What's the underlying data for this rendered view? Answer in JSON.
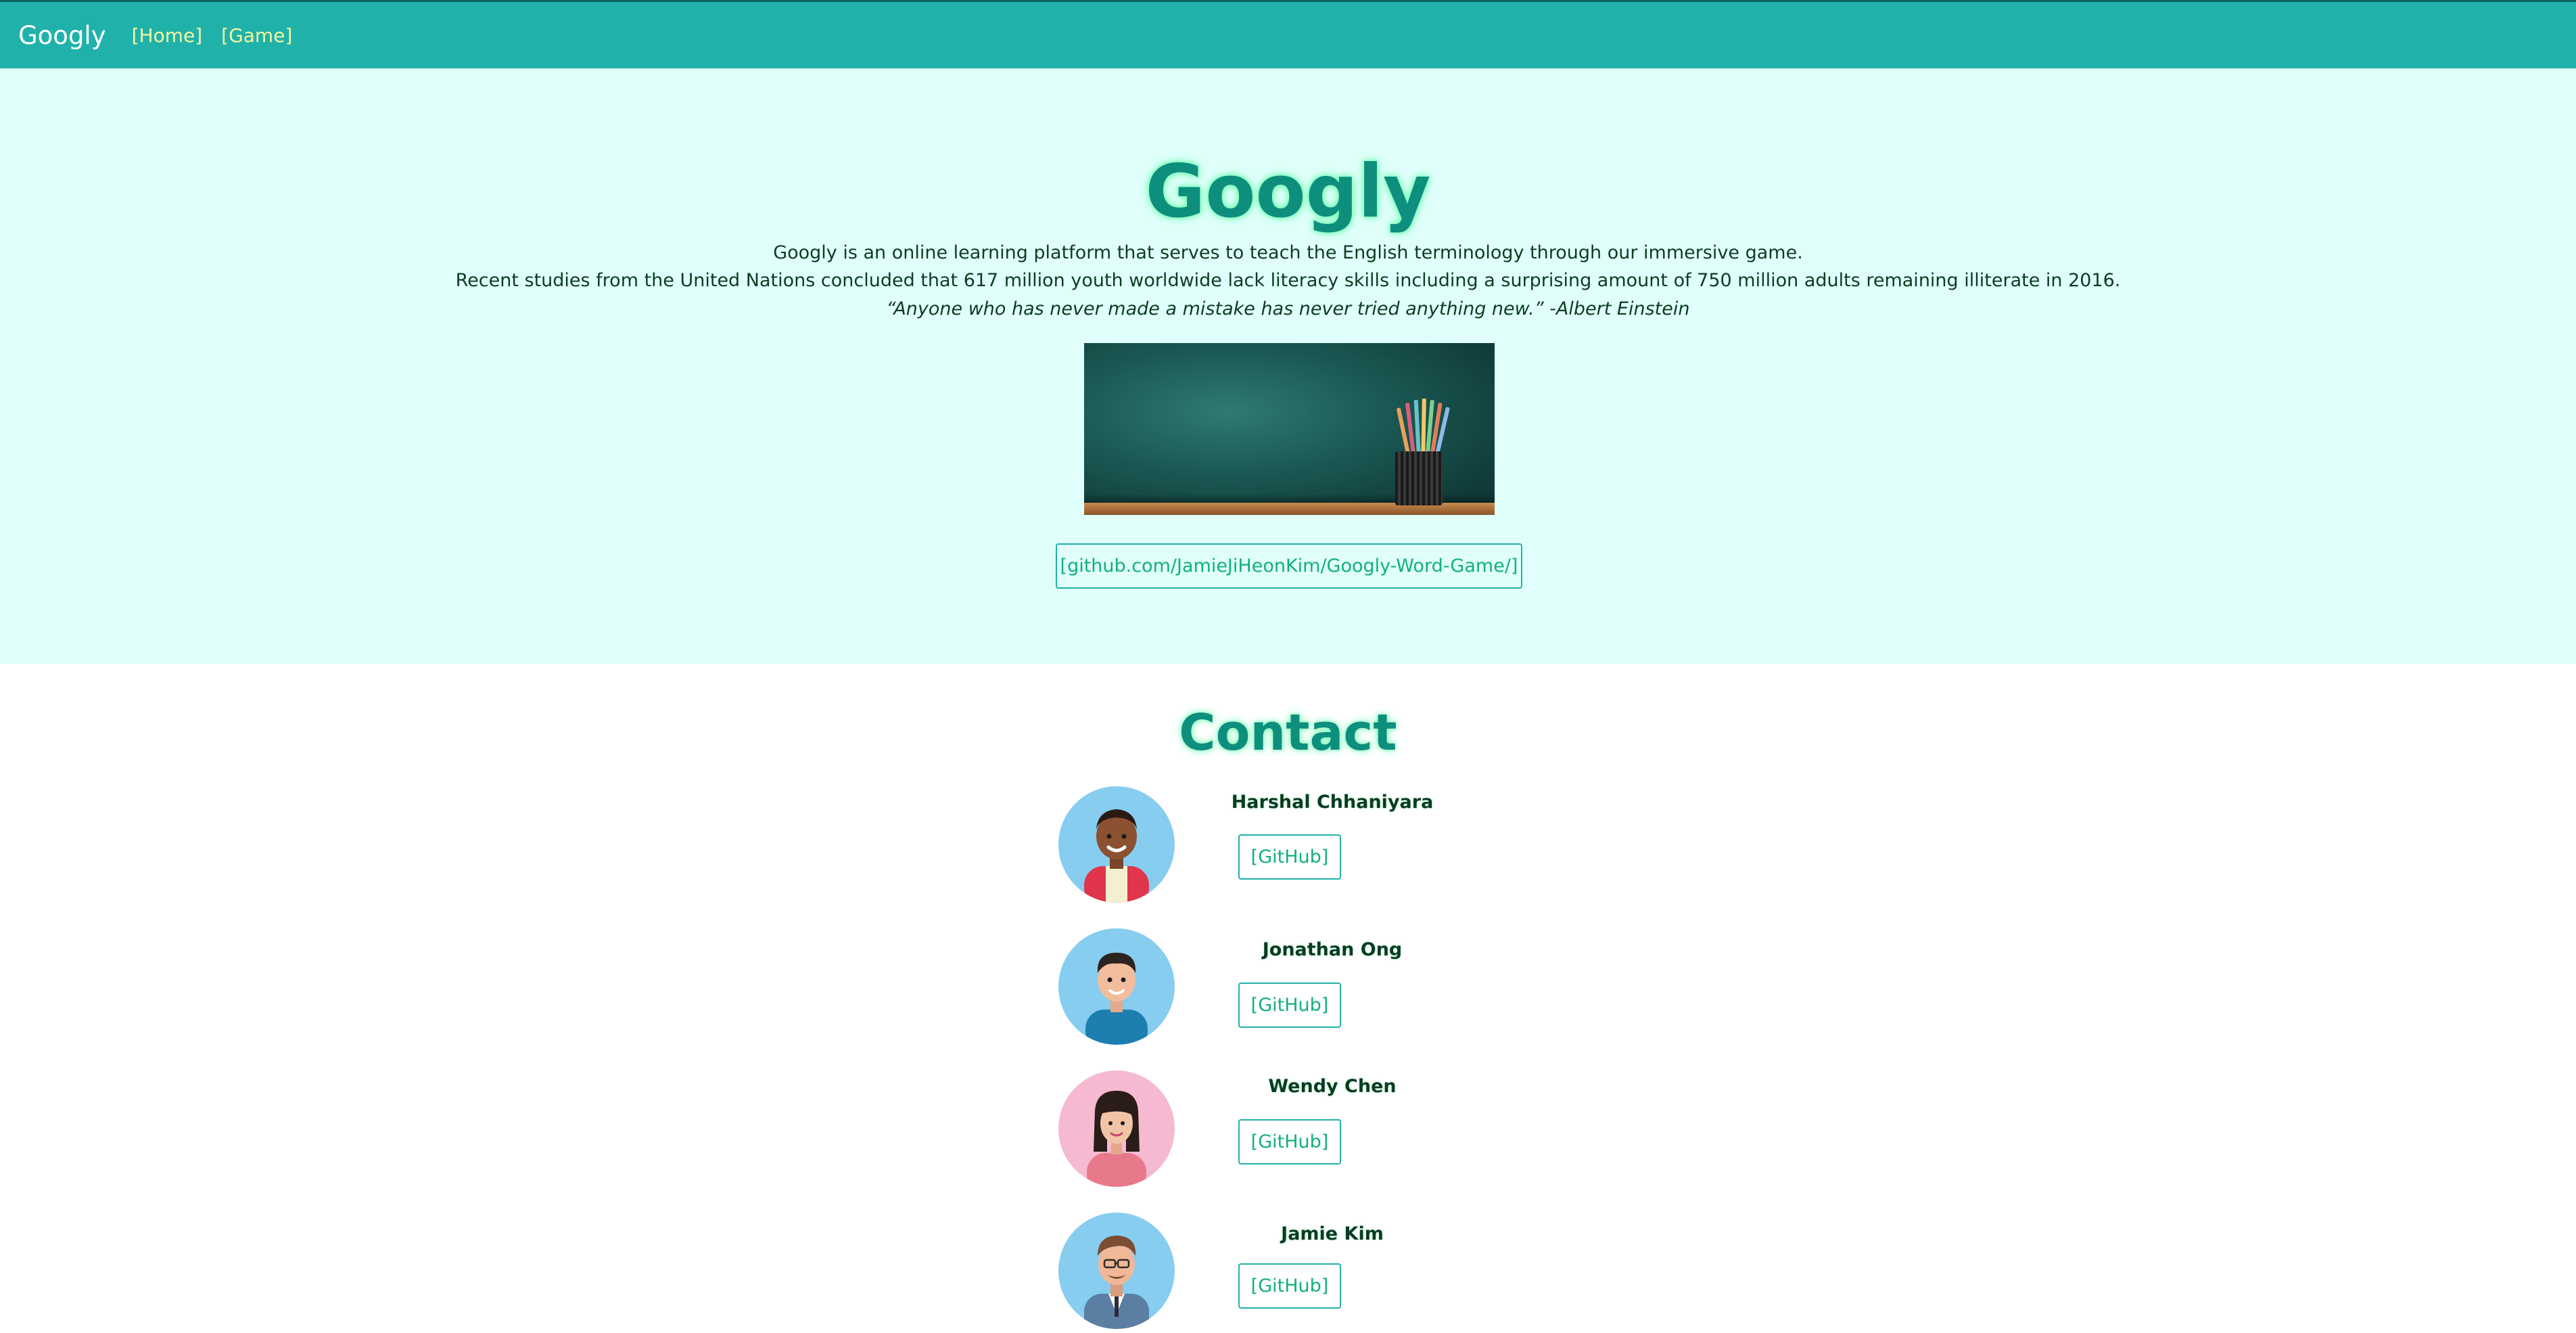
{
  "navbar": {
    "brand": "Googly",
    "links": [
      "[Home]",
      "[Game]"
    ]
  },
  "hero": {
    "title": "Googly",
    "line1": "Googly is an online learning platform that serves to teach the English terminology through our immersive game.",
    "line2": "Recent studies from the United Nations concluded that 617 million youth worldwide lack literacy skills including a surprising amount of 750 million adults remaining illiterate in 2016.",
    "quote": "“Anyone who has never made a mistake has never tried anything new.” -Albert Einstein",
    "repo_link": "[github.com/JamieJiHeonKim/Googly-Word-Game/]"
  },
  "contact": {
    "title": "Contact",
    "members": [
      {
        "name": "Harshal Chhaniyara",
        "button": "[GitHub]",
        "avatar_bg": "#86cdf0"
      },
      {
        "name": "Jonathan Ong",
        "button": "[GitHub]",
        "avatar_bg": "#86cdf0"
      },
      {
        "name": "Wendy Chen",
        "button": "[GitHub]",
        "avatar_bg": "#f5b9d1"
      },
      {
        "name": "Jamie Kim",
        "button": "[GitHub]",
        "avatar_bg": "#86cdf0"
      }
    ]
  },
  "colors": {
    "navbar": "#20b2aa",
    "hero_bg": "#e0fffb",
    "accent": "#11b07e",
    "title": "#0e8f7e"
  }
}
